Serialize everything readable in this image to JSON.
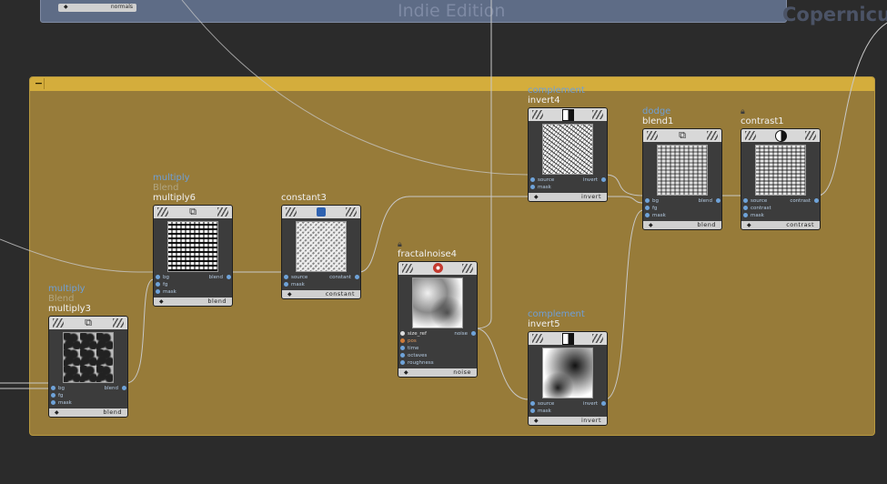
{
  "background": {
    "watermark": "Indie Edition",
    "context_label": "Copernicus",
    "top_node_type": "normals"
  },
  "network_box": {
    "header_color": "#d4ad3c",
    "body_color": "#977b39",
    "collapse_icon": "−"
  },
  "colors": {
    "wire": "#c8c8c8",
    "port_blue": "#6fa3d9",
    "port_orange": "#d07a38",
    "comment_blue": "#6f9fd6"
  },
  "nodes": {
    "multiply3": {
      "comment": "multiply",
      "subtitle": "Blend",
      "name": "multiply3",
      "icon": "layers-icon",
      "inputs": [
        "bg",
        "fg",
        "mask"
      ],
      "output": "blend",
      "type": "blend"
    },
    "multiply6": {
      "comment": "multiply",
      "subtitle": "Blend",
      "name": "multiply6",
      "icon": "layers-icon",
      "inputs": [
        "bg",
        "fg",
        "mask"
      ],
      "output": "blend",
      "type": "blend"
    },
    "constant3": {
      "name": "constant3",
      "icon": "color-swatch-icon",
      "inputs": [
        "source",
        "mask"
      ],
      "output": "constant",
      "type": "constant"
    },
    "fractalnoise4": {
      "name": "fractalnoise4",
      "lock": "lock-icon",
      "icon": "noise-icon",
      "inputs": [
        "size_ref",
        "pos",
        "time",
        "octaves",
        "roughness"
      ],
      "output": "noise",
      "type": "noise"
    },
    "invert4": {
      "comment": "complement",
      "name": "invert4",
      "icon": "invert-icon",
      "inputs": [
        "source",
        "mask"
      ],
      "output": "invert",
      "type": "invert"
    },
    "invert5": {
      "comment": "complement",
      "name": "invert5",
      "icon": "invert-icon",
      "inputs": [
        "source",
        "mask"
      ],
      "output": "invert",
      "type": "invert"
    },
    "blend1": {
      "comment": "dodge",
      "name": "blend1",
      "icon": "layers-icon",
      "inputs": [
        "bg",
        "fg",
        "mask"
      ],
      "output": "blend",
      "type": "blend"
    },
    "contrast1": {
      "lock": "lock-icon",
      "name": "contrast1",
      "icon": "contrast-icon",
      "inputs": [
        "source",
        "contrast",
        "mask"
      ],
      "output": "contrast",
      "type": "contrast"
    }
  }
}
